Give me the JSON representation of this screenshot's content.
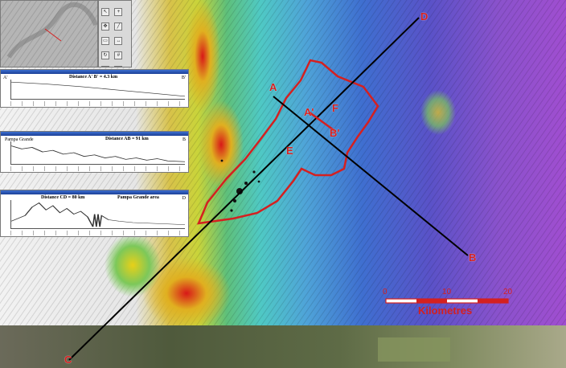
{
  "map": {
    "point_labels": {
      "A": "A",
      "B": "B",
      "C": "C",
      "D": "D",
      "A_prime": "A'",
      "B_prime": "B'",
      "E": "E",
      "F": "F"
    },
    "scale_bar": {
      "ticks": [
        "0",
        "10",
        "20"
      ],
      "unit_label": "Kilometres",
      "color": "#d42020"
    },
    "colors": {
      "study_area_outline": "#d42020",
      "transect_line": "#000000"
    }
  },
  "profiles": [
    {
      "title": "Distance A' B' = 4.3 km",
      "left_label": "A'",
      "right_label": "B'"
    },
    {
      "title": "Distance AB = 91 km",
      "left_label": "Pampa Grande",
      "right_label": "B"
    },
    {
      "title": "Distance CD = 80 km",
      "left_label": "",
      "area_label": "Pampa Grande area",
      "right_label": "D"
    }
  ],
  "toolbar": {
    "icons": [
      "pointer-icon",
      "zoom-icon",
      "pan-icon",
      "draw-line-icon",
      "select-icon",
      "measure-icon",
      "rotate-icon",
      "grid-icon",
      "layers-icon",
      "text-icon",
      "north-icon",
      "settings-icon",
      "save-icon",
      "print-icon"
    ]
  }
}
